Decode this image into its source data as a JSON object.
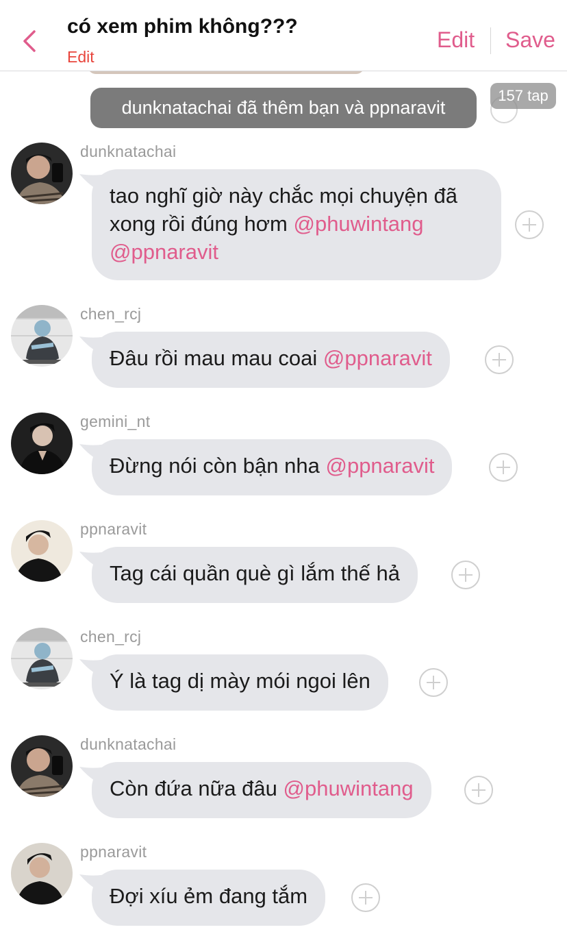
{
  "header": {
    "title": "có xem phim không???",
    "subtitle": "Edit",
    "edit_label": "Edit",
    "save_label": "Save",
    "accent": "#e05c8c",
    "back_icon": "chevron-left-icon"
  },
  "system_message": {
    "text": "dunknatachai đã thêm bạn và ppnaravit",
    "badge": "157 tap"
  },
  "messages": [
    {
      "user": "dunknatachai",
      "text": "tao nghĩ giờ này chắc mọi chuyện đã xong rồi đúng hơm ",
      "mention": "@phuwintang @ppnaravit"
    },
    {
      "user": "chen_rcj",
      "text": "Đâu rồi mau mau coai ",
      "mention": "@ppnaravit"
    },
    {
      "user": "gemini_nt",
      "text": "Đừng nói còn bận nha ",
      "mention": "@ppnaravit"
    },
    {
      "user": "ppnaravit",
      "text": "Tag cái quần què gì lắm thế hả",
      "mention": ""
    },
    {
      "user": "chen_rcj",
      "text": "Ý là tag dị mày mói ngoi lên",
      "mention": ""
    },
    {
      "user": "dunknatachai",
      "text": "Còn đứa nữa đâu ",
      "mention": "@phuwintang"
    },
    {
      "user": "ppnaravit",
      "text": "Đợi xíu ẻm đang tắm",
      "mention": ""
    }
  ]
}
